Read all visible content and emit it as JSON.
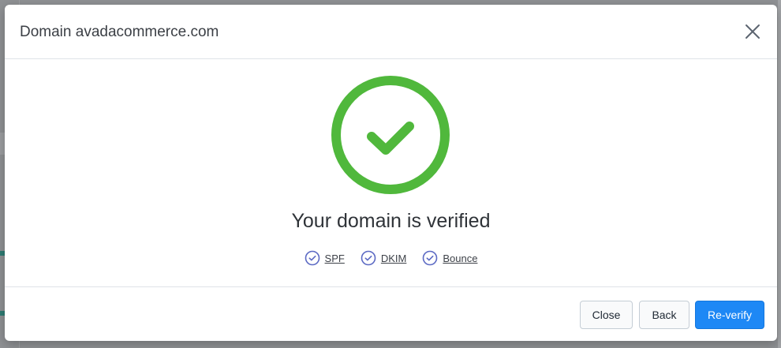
{
  "modal": {
    "title": "Domain avadacommerce.com",
    "heading": "Your domain is verified",
    "checks": [
      {
        "label": "SPF",
        "icon": "check-circle-icon"
      },
      {
        "label": "DKIM",
        "icon": "check-circle-icon"
      },
      {
        "label": "Bounce",
        "icon": "check-circle-icon"
      }
    ],
    "buttons": {
      "close": "Close",
      "back": "Back",
      "reverify": "Re-verify"
    }
  },
  "colors": {
    "success": "#50b83c",
    "check_badge": "#5c6ac4",
    "primary": "#1e88f5"
  },
  "icons": {
    "close": "close-icon",
    "verified": "success-check-circle-icon"
  }
}
